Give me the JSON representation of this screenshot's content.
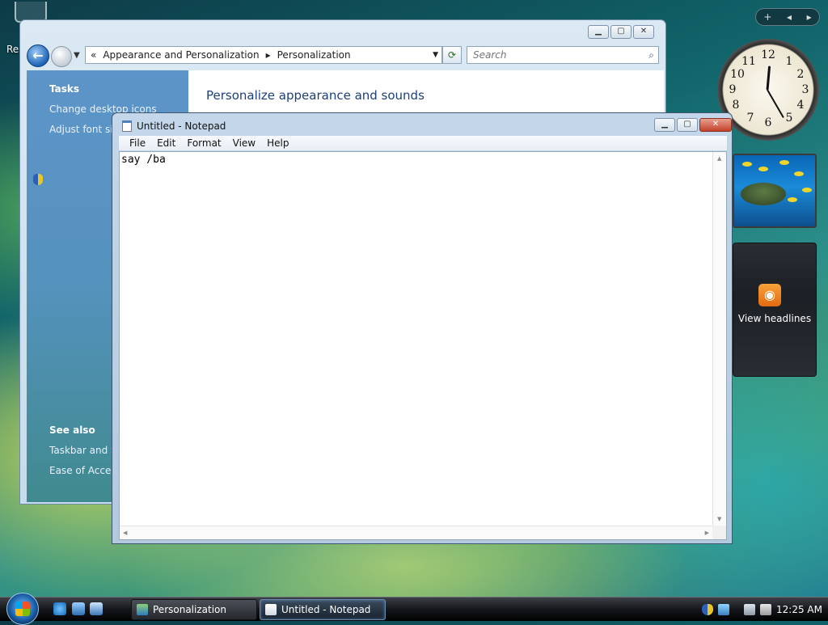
{
  "desktop": {
    "recycle_label": "Re"
  },
  "gadgets": {
    "control_plus": "+",
    "control_prev": "◂",
    "control_next": "▸",
    "clock_numbers": [
      "12",
      "1",
      "2",
      "3",
      "4",
      "5",
      "6",
      "7",
      "8",
      "9",
      "10",
      "11"
    ],
    "feed_label": "View headlines"
  },
  "personalization_window": {
    "address": {
      "chevron": "«",
      "crumb1": "Appearance and Personalization",
      "sep": "▸",
      "crumb2": "Personalization"
    },
    "search_placeholder": "Search",
    "tasks_heading": "Tasks",
    "tasks": [
      "Change desktop icons",
      "Adjust font size"
    ],
    "see_also_heading": "See also",
    "see_also": [
      "Taskbar and St",
      "Ease of Access"
    ],
    "content_title": "Personalize appearance and sounds"
  },
  "notepad": {
    "title": "Untitled - Notepad",
    "menu": [
      "File",
      "Edit",
      "Format",
      "View",
      "Help"
    ],
    "text": "say /ba"
  },
  "taskbar": {
    "buttons": [
      "Personalization",
      "Untitled - Notepad"
    ],
    "time": "12:25 AM"
  },
  "colors": {
    "accent": "#1c3f7c",
    "task_pane": "#5d94c9",
    "rss": "#f28b1e"
  }
}
